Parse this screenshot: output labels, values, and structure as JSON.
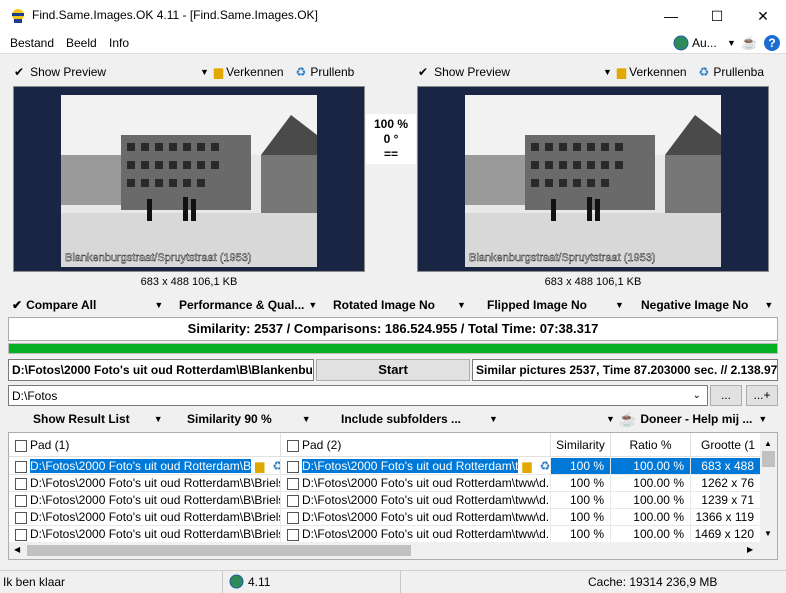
{
  "window": {
    "title": "Find.Same.Images.OK 4.11 - [Find.Same.Images.OK]"
  },
  "menu": {
    "items": [
      "Bestand",
      "Beeld",
      "Info"
    ],
    "lang_label": "Au..."
  },
  "preview_left": {
    "show_preview": "Show Preview",
    "explore": "Verkennen",
    "trash": "Prullenb",
    "caption": "683 x 488 106,1 KB",
    "photo_label": "Blankenburgstraat/Spruytstraat (1953)"
  },
  "preview_right": {
    "show_preview": "Show Preview",
    "explore": "Verkennen",
    "trash": "Prullenba",
    "caption": "683 x 488 106,1 KB",
    "photo_label": "Blankenburgstraat/Spruytstraat (1953)"
  },
  "center_info": {
    "percent": "100 %",
    "angle": "0 °",
    "equal": "=="
  },
  "options": {
    "compare_all": "Compare All",
    "performance": "Performance & Qual...",
    "rotated": "Rotated Image No",
    "flipped": "Flipped Image No",
    "negative": "Negative Image No"
  },
  "similarity_summary": "Similarity: 2537 / Comparisons: 186.524.955 / Total Time: 07:38.317",
  "progress": {
    "fraction": 1.0,
    "color": "#06b025"
  },
  "current_path": "D:\\Fotos\\2000 Foto's uit oud Rotterdam\\B\\Blankenbur",
  "start_label": "Start",
  "result_info": "Similar pictures 2537, Time 87.203000 sec. // 2.138.97",
  "folder_input": "D:\\Fotos",
  "browse_label": "...",
  "add_label": "...+",
  "options2": {
    "show_result": "Show Result List",
    "similarity": "Similarity 90 %",
    "subfolders": "Include subfolders ...",
    "donate": "Doneer - Help mij ..."
  },
  "grid": {
    "headers": {
      "pad1": "Pad (1)",
      "pad2": "Pad (2)",
      "similarity": "Similarity",
      "ratio": "Ratio %",
      "size": "Grootte (1"
    },
    "rows": [
      {
        "pad1": "D:\\Fotos\\2000 Foto's uit oud Rotterdam\\B",
        "pad2": "D:\\Fotos\\2000 Foto's uit oud Rotterdam\\t",
        "similarity": "100 %",
        "ratio": "100.00 %",
        "size": "683 x 488"
      },
      {
        "pad1": "D:\\Fotos\\2000 Foto's uit oud Rotterdam\\B\\Briels...",
        "pad2": "D:\\Fotos\\2000 Foto's uit oud Rotterdam\\tww\\d...",
        "similarity": "100 %",
        "ratio": "100.00 %",
        "size": "1262 x 76"
      },
      {
        "pad1": "D:\\Fotos\\2000 Foto's uit oud Rotterdam\\B\\Briels...",
        "pad2": "D:\\Fotos\\2000 Foto's uit oud Rotterdam\\tww\\d...",
        "similarity": "100 %",
        "ratio": "100.00 %",
        "size": "1239 x 71"
      },
      {
        "pad1": "D:\\Fotos\\2000 Foto's uit oud Rotterdam\\B\\Briels...",
        "pad2": "D:\\Fotos\\2000 Foto's uit oud Rotterdam\\tww\\d...",
        "similarity": "100 %",
        "ratio": "100.00 %",
        "size": "1366 x 119"
      },
      {
        "pad1": "D:\\Fotos\\2000 Foto's uit oud Rotterdam\\B\\Briels...",
        "pad2": "D:\\Fotos\\2000 Foto's uit oud Rotterdam\\tww\\d...",
        "similarity": "100 %",
        "ratio": "100.00 %",
        "size": "1469 x 120"
      }
    ]
  },
  "status": {
    "ready": "Ik ben klaar",
    "version": "4.11",
    "cache": "Cache: 19314 236,9 MB"
  }
}
